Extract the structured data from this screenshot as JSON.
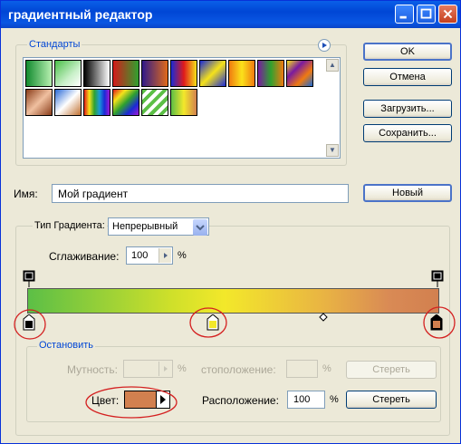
{
  "window": {
    "title": "градиентный редактор"
  },
  "presets": {
    "label": "Стандарты",
    "swatches": [
      {
        "name": "foreground-to-background",
        "css": "linear-gradient(to right,#118a2f,#b8f0b0)"
      },
      {
        "name": "foreground-to-transparent",
        "css": "linear-gradient(135deg,#4bbf49,#c8f0c8 60%,#fff)"
      },
      {
        "name": "black-white",
        "css": "linear-gradient(to right,#000,#fff)"
      },
      {
        "name": "red-green",
        "css": "linear-gradient(to right,#d41a1a,#2fa12f)"
      },
      {
        "name": "violet-orange",
        "css": "linear-gradient(to right,#2f1a8a,#e06a1a)"
      },
      {
        "name": "blue-red-yellow",
        "css": "linear-gradient(to right,#1a2ad6,#e01a1a,#f5e21a)"
      },
      {
        "name": "blue-yellow-blue",
        "css": "linear-gradient(135deg,#1a2ad6,#f5e21a 50%,#1a2ad6)"
      },
      {
        "name": "orange-yellow-orange",
        "css": "linear-gradient(to right,#f07a10,#fbe21a,#f07a10)"
      },
      {
        "name": "violet-green-orange",
        "css": "linear-gradient(to right,#7a1aa0,#2fa12f,#f07a10)"
      },
      {
        "name": "yellow-violet-orange-blue",
        "css": "linear-gradient(135deg,#f5e21a,#7a1aa0,#f07a10,#1a6ad6)"
      },
      {
        "name": "copper",
        "css": "linear-gradient(135deg,#8a3d1a,#f0c0a0 50%,#8a3d1a)"
      },
      {
        "name": "chrome",
        "css": "linear-gradient(135deg,#2a6ad6,#fff 50%,#c07030)"
      },
      {
        "name": "spectrum",
        "css": "linear-gradient(to right,#e01a1a,#f5e21a,#2fa12f,#1a9ad6,#1a2ad6,#a01ad6)"
      },
      {
        "name": "transparent-rainbow",
        "css": "linear-gradient(135deg,#e01a1a,#f5e21a,#2fa12f,#1a2ad6,#a01ad6)"
      },
      {
        "name": "transparent-stripes",
        "css": "repeating-linear-gradient(135deg,#5cbf46 0 4px,#fff 4px 8px)"
      },
      {
        "name": "user-gradient",
        "css": "linear-gradient(to right,#5cbf46,#f3e82a,#d2804f)"
      }
    ]
  },
  "buttons": {
    "ok": "OK",
    "cancel": "Отмена",
    "load": "Загрузить...",
    "save": "Сохранить...",
    "new": "Новый",
    "delete_opacity": "Стереть",
    "delete_color": "Стереть"
  },
  "name": {
    "label": "Имя:",
    "value": "Мой градиент"
  },
  "gradient_type": {
    "label": "Тип Градиента:",
    "value": "Непрерывный",
    "smoothness_label": "Сглаживание:",
    "smoothness_value": "100",
    "smoothness_unit": "%"
  },
  "gradient": {
    "colors": [
      "#5cbf46",
      "#cfe02a",
      "#f3e82a",
      "#e9b443",
      "#d2804f"
    ],
    "color_stops": [
      {
        "color": "#000000",
        "position_pct": 0
      },
      {
        "color": "#f3e82a",
        "position_pct": 45
      },
      {
        "color": "#d2804f",
        "position_pct": 100
      }
    ],
    "opacity_stops": [
      {
        "opacity_pct": 100,
        "position_pct": 0
      },
      {
        "opacity_pct": 100,
        "position_pct": 100
      }
    ],
    "midpoint_pct": 72
  },
  "stops": {
    "label": "Остановить",
    "opacity_label": "Мутность:",
    "opacity_unit": "%",
    "opacity_location_label": "стоположение:",
    "opacity_location_unit": "%",
    "color_label": "Цвет:",
    "color_value": "#d2804f",
    "location_label": "Расположение:",
    "location_value": "100",
    "location_unit": "%"
  }
}
